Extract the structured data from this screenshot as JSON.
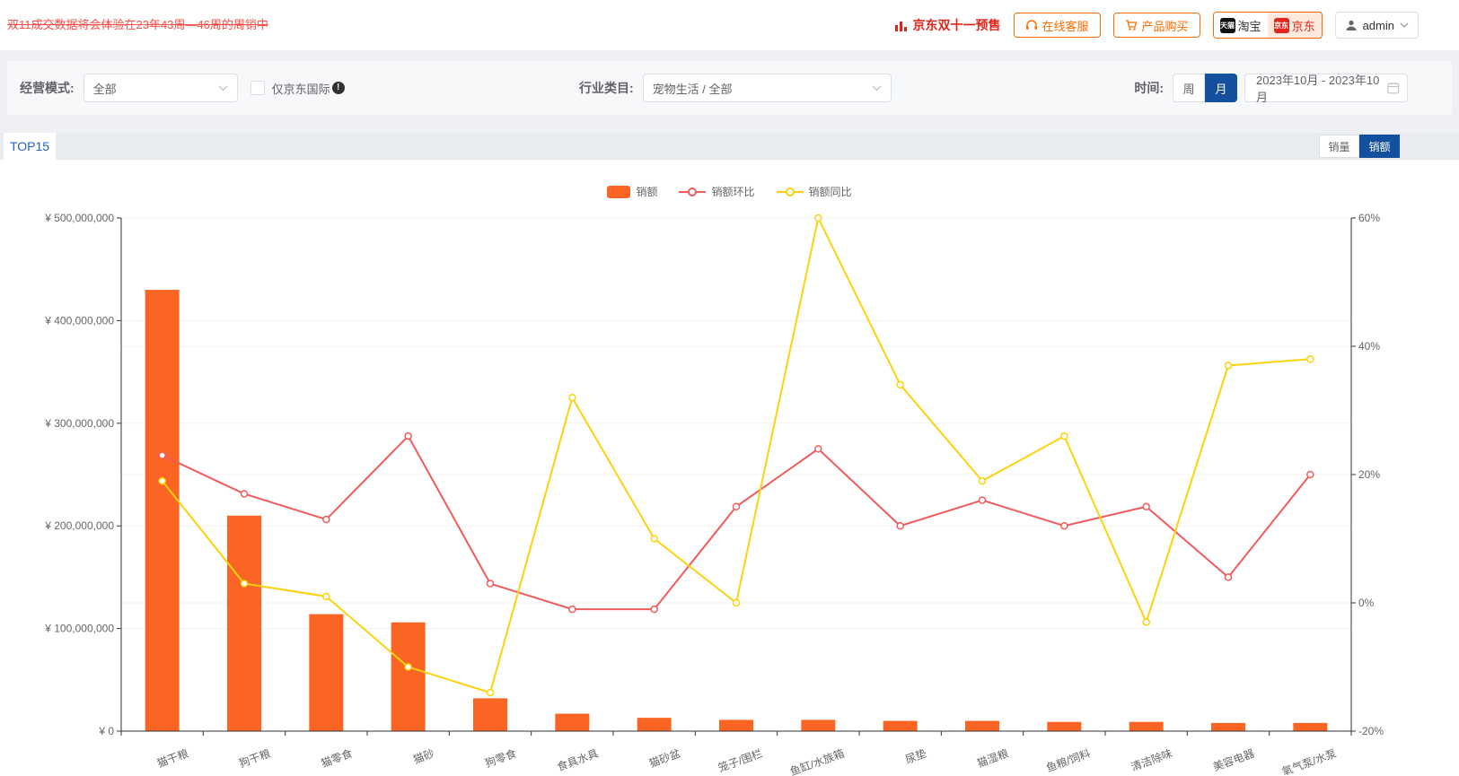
{
  "announcement": "双11成交数据将会体验在23年43周—46周的周销中",
  "topbar": {
    "presale_label": "京东双十一预售",
    "service_label": "在线客服",
    "purchase_label": "产品购买",
    "tmall_badge": "天猫",
    "taobao_label": "淘宝",
    "jd_badge": "京东",
    "jd_label": "京东",
    "user_label": "admin"
  },
  "filters": {
    "mode_label": "经营模式:",
    "mode_value": "全部",
    "jd_intl_label": "仅京东国际",
    "category_label": "行业类目:",
    "category_value": "宠物生活 / 全部",
    "time_label": "时间:",
    "week_label": "周",
    "month_label": "月",
    "date_range": "2023年10月 - 2023年10月"
  },
  "tab_label": "TOP15",
  "view_toggle": {
    "qty_label": "销量",
    "amount_label": "销额"
  },
  "colors": {
    "accent_blue": "#15509e",
    "brand_orange": "#ff6a00",
    "jd_red": "#e1251b",
    "announcement_red": "#f5504a",
    "bar_orange": "#fb6523",
    "line_red": "#f15b5b",
    "line_yellow": "#fdd20d"
  },
  "icons": {
    "bar-chart-icon": "three red bars",
    "headset-icon": "headset outline",
    "cart-icon": "shopping cart outline",
    "user-icon": "person silhouette",
    "chevron-down-icon": "v arrow",
    "info-icon": "filled circle with !",
    "calendar-icon": "calendar grid",
    "checkbox": "empty square"
  },
  "chart_data": {
    "type": "bar+line",
    "categories": [
      "猫干粮",
      "狗干粮",
      "猫零食",
      "猫砂",
      "狗零食",
      "食具水具",
      "猫砂盆",
      "笼子/围栏",
      "鱼缸/水族箱",
      "尿垫",
      "猫湿粮",
      "鱼粮/饲料",
      "清洁除味",
      "美容电器",
      "氧气泵/水泵"
    ],
    "series": [
      {
        "name": "销额",
        "type": "bar",
        "axis": "left",
        "color": "#fb6523",
        "values": [
          430000000,
          210000000,
          114000000,
          106000000,
          32000000,
          17000000,
          13000000,
          11000000,
          11000000,
          10000000,
          10000000,
          9000000,
          9000000,
          8000000,
          8000000
        ]
      },
      {
        "name": "销额环比",
        "type": "line",
        "axis": "right",
        "color": "#f15b5b",
        "values": [
          23,
          17,
          13,
          26,
          3,
          -1,
          -1,
          15,
          24,
          12,
          16,
          12,
          15,
          4,
          20
        ]
      },
      {
        "name": "销额同比",
        "type": "line",
        "axis": "right",
        "color": "#fdd20d",
        "values": [
          19,
          3,
          1,
          -10,
          -14,
          32,
          10,
          0,
          60,
          34,
          19,
          26,
          -3,
          37,
          38
        ]
      }
    ],
    "left_axis": {
      "min": 0,
      "max": 500000000,
      "tick_step": 100000000,
      "tick_labels": [
        "¥ 0",
        "¥ 100,000,000",
        "¥ 200,000,000",
        "¥ 300,000,000",
        "¥ 400,000,000",
        "¥ 500,000,000"
      ]
    },
    "right_axis": {
      "min": -20,
      "max": 60,
      "tick_step": 20,
      "tick_labels": [
        "-20%",
        "0%",
        "20%",
        "40%",
        "60%"
      ]
    },
    "legend_position": "top-center",
    "grid": true
  }
}
